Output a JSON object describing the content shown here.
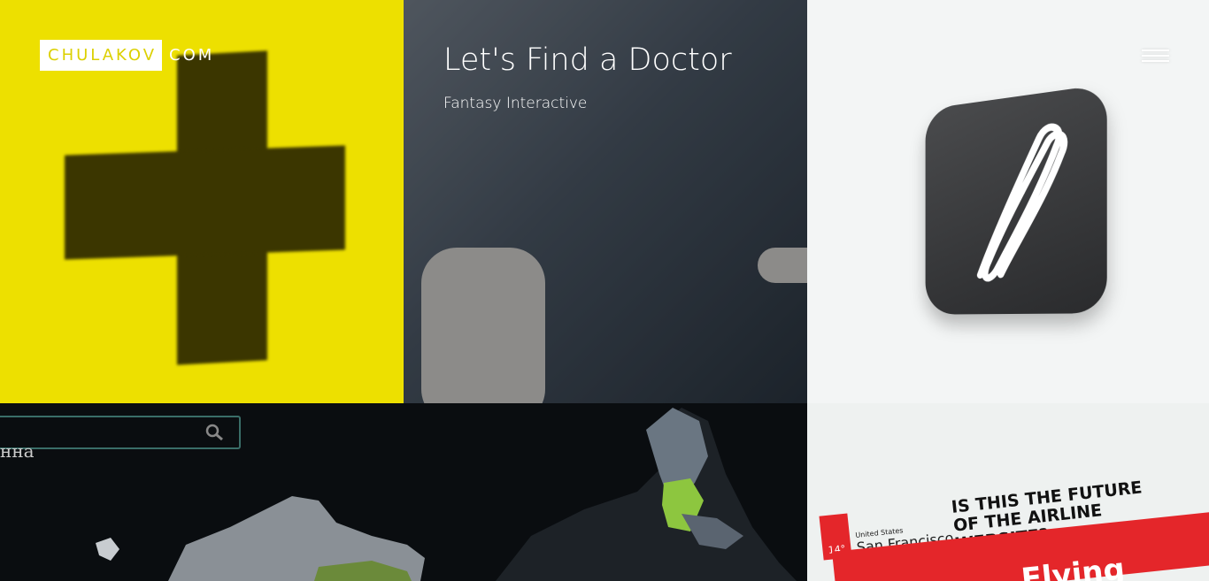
{
  "header": {
    "logo_box": "CHULAKOV",
    "logo_rest": "COM"
  },
  "menu": {
    "icon": "hamburger-menu-icon"
  },
  "tiles": [
    {
      "id": "cross",
      "color": "#ede000"
    },
    {
      "id": "doctor",
      "title": "Let's Find a Doctor",
      "subtitle": "Fantasy Interactive"
    },
    {
      "id": "app-icon",
      "color": "#f3f5f5"
    },
    {
      "id": "map",
      "search_text": "нна",
      "icons": [
        "search-icon"
      ]
    },
    {
      "id": "airline",
      "headline": "IS THIS THE FUTURE OF THE AIRLINE WEBSITE?",
      "location_small": "United States",
      "city": "San Francisco",
      "temperature": "14°",
      "banner_text": "Flying",
      "accent": "#e4262a"
    }
  ]
}
